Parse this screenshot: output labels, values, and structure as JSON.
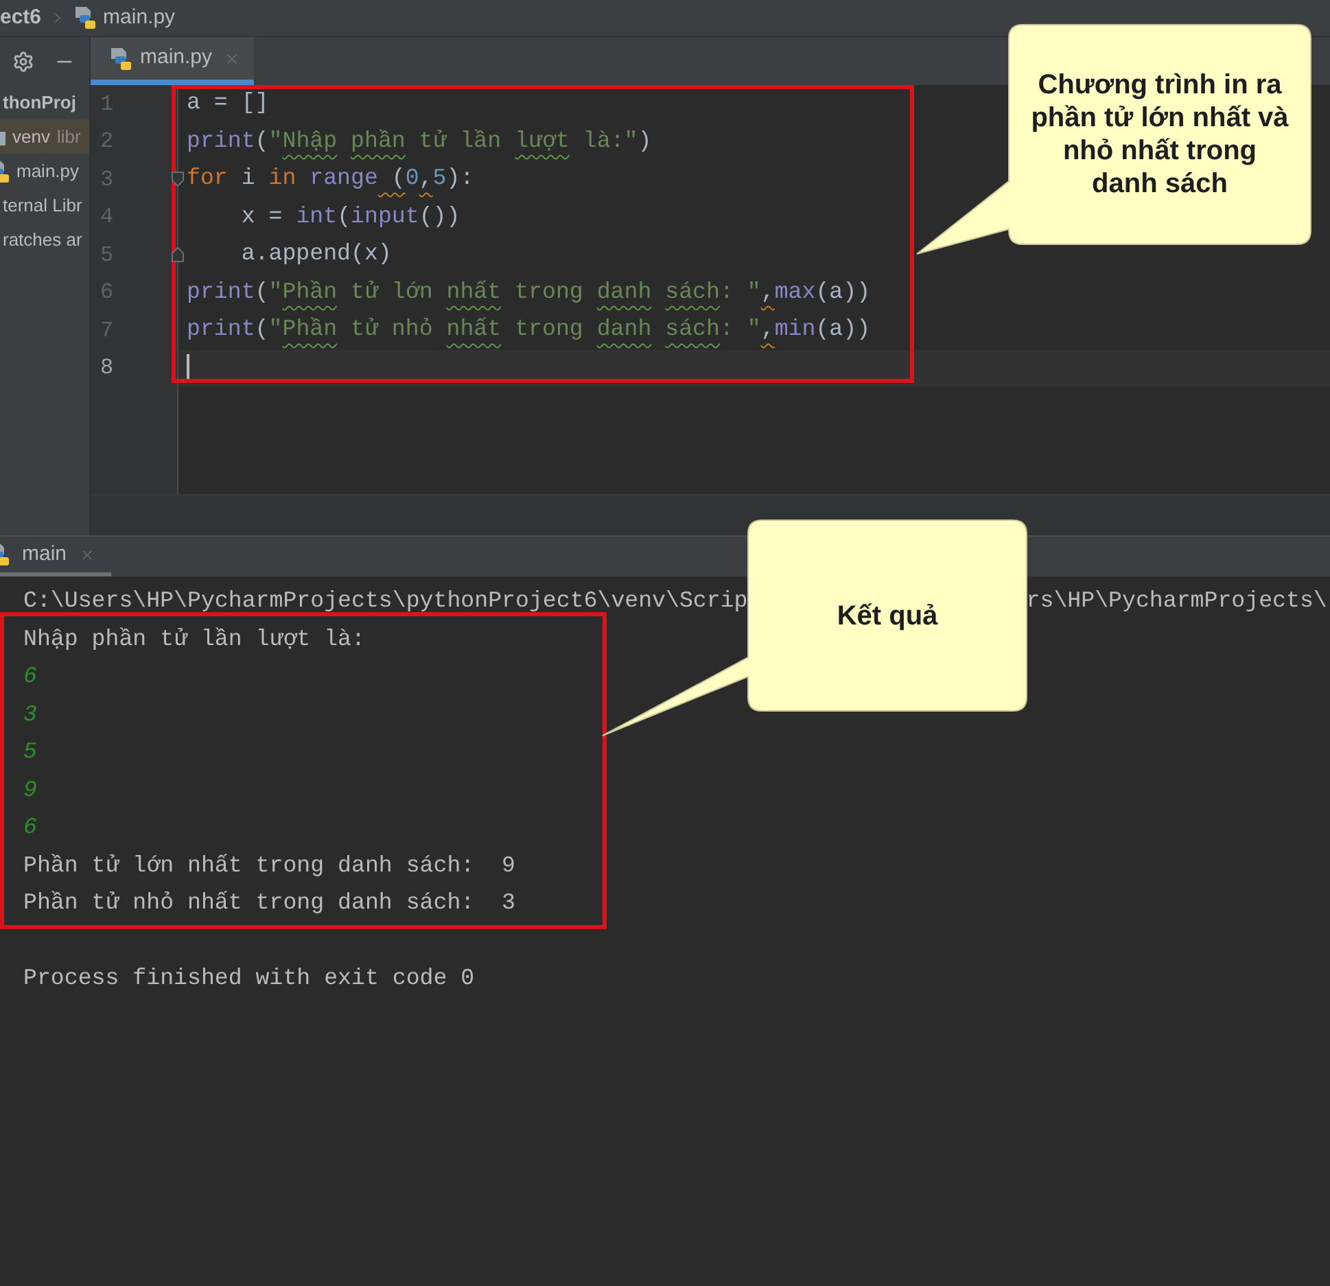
{
  "breadcrumb": [
    {
      "label": "ect6",
      "kind": "project"
    },
    {
      "label": "main.py",
      "kind": "file"
    }
  ],
  "project_panel": {
    "tree": [
      {
        "label": "thonProj",
        "kind": "project",
        "highlighted": false,
        "children": [
          {
            "label": "venv",
            "hint": "libr",
            "kind": "folder",
            "highlighted": true
          },
          {
            "label": "main.py",
            "kind": "file",
            "highlighted": false
          }
        ]
      },
      {
        "label": "ternal Libr",
        "kind": "libraries",
        "highlighted": false
      },
      {
        "label": "ratches ar",
        "kind": "scratches",
        "highlighted": false
      }
    ]
  },
  "editor": {
    "tab": {
      "label": "main.py",
      "selected": true
    },
    "lines": [
      {
        "number": "1",
        "kind": "code",
        "current": false,
        "tokens": [
          {
            "text": "a = []",
            "kind": "plain"
          }
        ]
      },
      {
        "number": "2",
        "kind": "code",
        "current": false,
        "tokens": [
          {
            "text": "print",
            "kind": "builtin"
          },
          {
            "text": "(",
            "kind": "plain"
          },
          {
            "text": "\"",
            "kind": "string"
          },
          {
            "text": "Nhập ",
            "kind": "misspelled"
          },
          {
            "text": "phần",
            "kind": "misspelled"
          },
          {
            "text": " tử lần ",
            "kind": "string"
          },
          {
            "text": "lượt",
            "kind": "misspelled"
          },
          {
            "text": " là:\"",
            "kind": "string"
          },
          {
            "text": ")",
            "kind": "plain"
          }
        ]
      },
      {
        "number": "3",
        "kind": "opener",
        "current": false,
        "tokens": [
          {
            "text": "for",
            "kind": "keyword"
          },
          {
            "text": " i ",
            "kind": "plain"
          },
          {
            "text": "in",
            "kind": "keyword"
          },
          {
            "text": " range",
            "kind": "builtin"
          },
          {
            "text": " (",
            "kind": "flagged"
          },
          {
            "text": "0",
            "kind": "number"
          },
          {
            "text": ",",
            "kind": "flagged"
          },
          {
            "text": "5",
            "kind": "number"
          },
          {
            "text": "):",
            "kind": "plain"
          }
        ]
      },
      {
        "number": "4",
        "kind": "code",
        "current": false,
        "tokens": [
          {
            "text": "    x = ",
            "kind": "plain"
          },
          {
            "text": "int",
            "kind": "builtin"
          },
          {
            "text": "(",
            "kind": "plain"
          },
          {
            "text": "input",
            "kind": "builtin"
          },
          {
            "text": "())",
            "kind": "plain"
          }
        ]
      },
      {
        "number": "5",
        "kind": "closer",
        "current": false,
        "tokens": [
          {
            "text": "    a.append(x)",
            "kind": "plain"
          }
        ]
      },
      {
        "number": "6",
        "kind": "code",
        "current": false,
        "tokens": [
          {
            "text": "print",
            "kind": "builtin"
          },
          {
            "text": "(",
            "kind": "plain"
          },
          {
            "text": "\"",
            "kind": "string"
          },
          {
            "text": "Phần",
            "kind": "misspelled"
          },
          {
            "text": " tử lớn ",
            "kind": "string"
          },
          {
            "text": "nhất",
            "kind": "misspelled"
          },
          {
            "text": " trong ",
            "kind": "string"
          },
          {
            "text": "danh ",
            "kind": "misspelled"
          },
          {
            "text": "sách",
            "kind": "misspelled"
          },
          {
            "text": ": \"",
            "kind": "string"
          },
          {
            "text": ",",
            "kind": "flagged"
          },
          {
            "text": "max",
            "kind": "builtin"
          },
          {
            "text": "(a))",
            "kind": "plain"
          }
        ]
      },
      {
        "number": "7",
        "kind": "code",
        "current": false,
        "tokens": [
          {
            "text": "print",
            "kind": "builtin"
          },
          {
            "text": "(",
            "kind": "plain"
          },
          {
            "text": "\"",
            "kind": "string"
          },
          {
            "text": "Phần",
            "kind": "misspelled"
          },
          {
            "text": " tử nhỏ ",
            "kind": "string"
          },
          {
            "text": "nhất",
            "kind": "misspelled"
          },
          {
            "text": " trong ",
            "kind": "string"
          },
          {
            "text": "danh ",
            "kind": "misspelled"
          },
          {
            "text": "sách",
            "kind": "misspelled"
          },
          {
            "text": ": \"",
            "kind": "string"
          },
          {
            "text": ",",
            "kind": "flagged"
          },
          {
            "text": "min",
            "kind": "builtin"
          },
          {
            "text": "(a))",
            "kind": "plain"
          }
        ]
      },
      {
        "number": "8",
        "kind": "code",
        "current": true
      }
    ]
  },
  "console": {
    "tab": {
      "label": "main",
      "selected": true
    },
    "command_line": {
      "start": "C:\\Users\\HP\\PycharmProjects\\pythonProject6\\venv\\Scrip",
      "end": "rs\\HP\\PycharmProjects\\"
    },
    "lines": [
      {
        "text": "Nhập phần tử lần lượt là:",
        "kind": "output"
      },
      {
        "text": "6",
        "kind": "input"
      },
      {
        "text": "3",
        "kind": "input"
      },
      {
        "text": "5",
        "kind": "input"
      },
      {
        "text": "9",
        "kind": "input"
      },
      {
        "text": "6",
        "kind": "input"
      },
      {
        "text": "Phần tử lớn nhất trong danh sách:  9",
        "kind": "output"
      },
      {
        "text": "Phần tử nhỏ nhất trong danh sách:  3",
        "kind": "output"
      }
    ],
    "exit_message": "Process finished with exit code 0"
  },
  "callouts": [
    {
      "text": "Chương trình in ra phần tử lớn nhất và nhỏ nhất trong danh sách"
    },
    {
      "text": "Kết quả"
    }
  ]
}
